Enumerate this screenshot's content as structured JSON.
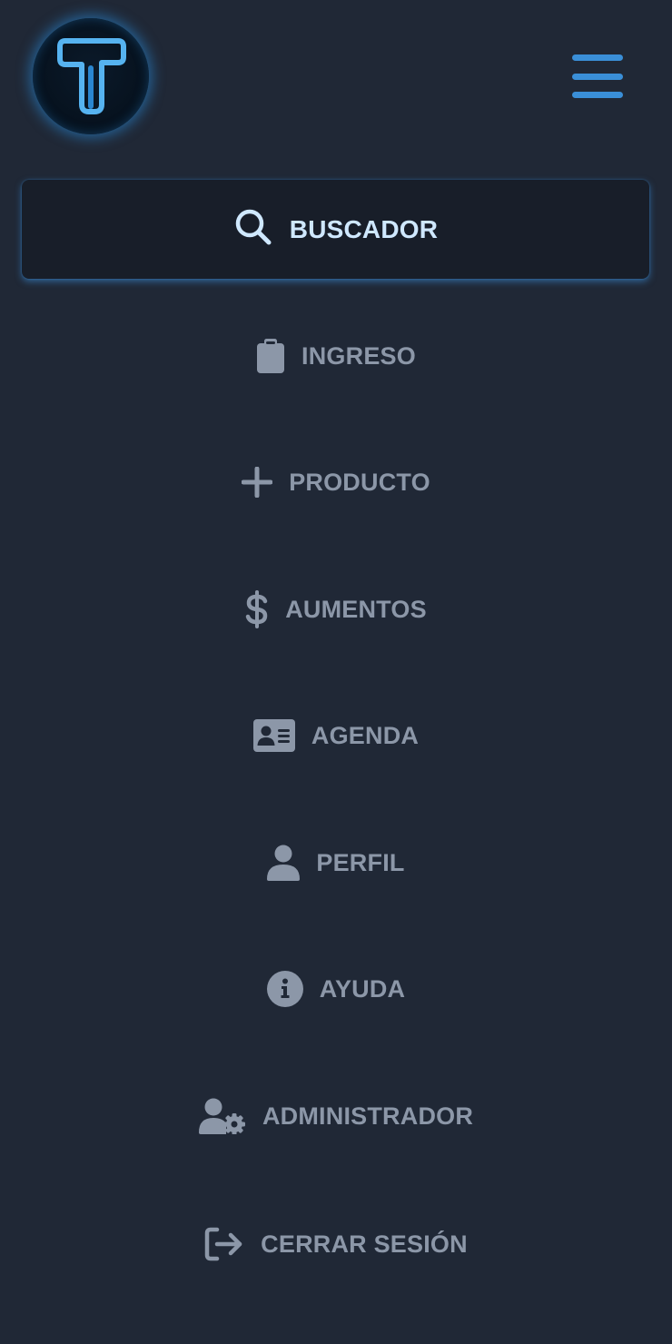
{
  "header": {
    "logo_icon": "t-logo-icon",
    "menu_icon": "hamburger-menu-icon"
  },
  "search": {
    "label": "BUSCADOR",
    "icon": "search-icon"
  },
  "nav": {
    "items": [
      {
        "label": "INGRESO",
        "icon": "clipboard-icon"
      },
      {
        "label": "PRODUCTO",
        "icon": "plus-icon"
      },
      {
        "label": "AUMENTOS",
        "icon": "dollar-icon"
      },
      {
        "label": "AGENDA",
        "icon": "contact-card-icon"
      },
      {
        "label": "PERFIL",
        "icon": "user-icon"
      },
      {
        "label": "AYUDA",
        "icon": "info-icon"
      },
      {
        "label": "ADMINISTRADOR",
        "icon": "user-gear-icon"
      },
      {
        "label": "CERRAR SESIÓN",
        "icon": "logout-icon"
      }
    ]
  },
  "colors": {
    "background": "#202836",
    "accent": "#3a8fd8",
    "nav_text": "#8c97a8",
    "search_text": "#cfe8ff"
  }
}
